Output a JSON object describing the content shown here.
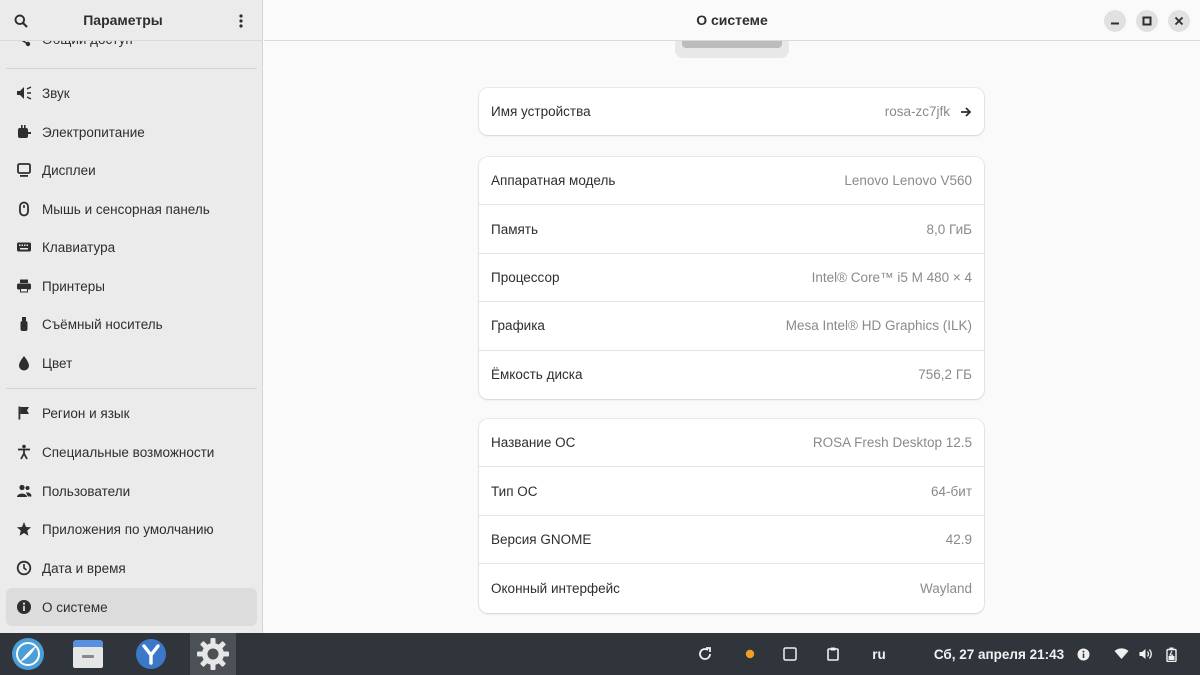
{
  "sidebar": {
    "title": "Параметры",
    "items": [
      {
        "label": "Общий доступ",
        "icon": "share-icon"
      },
      {
        "label": "Звук",
        "icon": "speaker-icon"
      },
      {
        "label": "Электропитание",
        "icon": "power-icon"
      },
      {
        "label": "Дисплеи",
        "icon": "display-icon"
      },
      {
        "label": "Мышь и сенсорная панель",
        "icon": "mouse-icon"
      },
      {
        "label": "Клавиатура",
        "icon": "keyboard-icon"
      },
      {
        "label": "Принтеры",
        "icon": "printer-icon"
      },
      {
        "label": "Съёмный носитель",
        "icon": "usb-icon"
      },
      {
        "label": "Цвет",
        "icon": "color-icon"
      },
      {
        "label": "Регион и язык",
        "icon": "flag-icon"
      },
      {
        "label": "Специальные возможности",
        "icon": "accessibility-icon"
      },
      {
        "label": "Пользователи",
        "icon": "users-icon"
      },
      {
        "label": "Приложения по умолчанию",
        "icon": "star-icon"
      },
      {
        "label": "Дата и время",
        "icon": "clock-icon"
      },
      {
        "label": "О системе",
        "icon": "info-icon"
      }
    ]
  },
  "header": {
    "title": "О системе"
  },
  "device": {
    "label": "Имя устройства",
    "value": "rosa-zc7jfk"
  },
  "hardware": [
    {
      "label": "Аппаратная модель",
      "value": "Lenovo Lenovo V560"
    },
    {
      "label": "Память",
      "value": "8,0 ГиБ"
    },
    {
      "label": "Процессор",
      "value": "Intel® Core™ i5 M 480 × 4"
    },
    {
      "label": "Графика",
      "value": "Mesa Intel® HD Graphics (ILK)"
    },
    {
      "label": "Ёмкость диска",
      "value": "756,2 ГБ"
    }
  ],
  "os": [
    {
      "label": "Название ОС",
      "value": "ROSA Fresh Desktop 12.5"
    },
    {
      "label": "Тип ОС",
      "value": "64-бит"
    },
    {
      "label": "Версия GNOME",
      "value": "42.9"
    },
    {
      "label": "Оконный интерфейс",
      "value": "Wayland"
    }
  ],
  "taskbar": {
    "language": "ru",
    "clock": "Сб, 27 апреля  21:43",
    "colors": {
      "bg": "#2f353b",
      "indicator": "#f0a020"
    }
  }
}
